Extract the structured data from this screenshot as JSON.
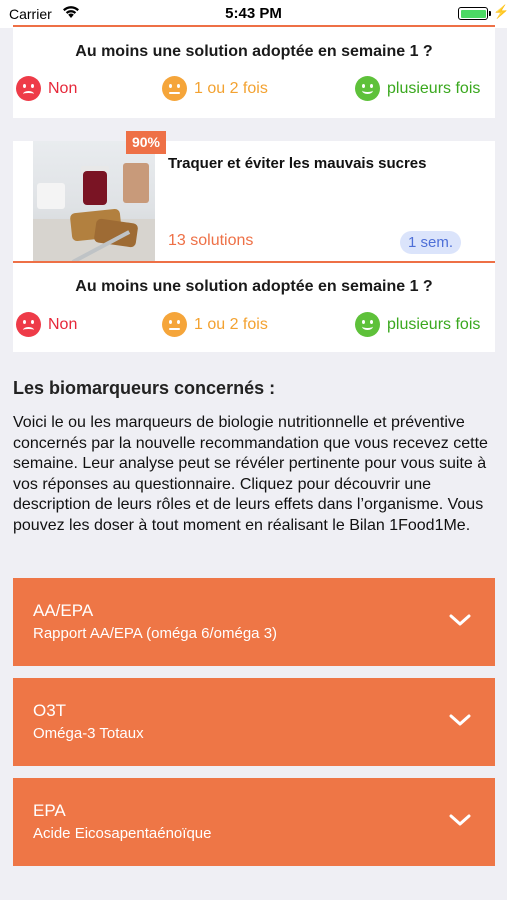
{
  "status_bar": {
    "carrier": "Carrier",
    "time": "5:43 PM",
    "battery_level": 1.0,
    "charging_glyph": "⚡"
  },
  "colors": {
    "accent": "#ee7046",
    "no": "#e6283a",
    "some": "#f3a231",
    "many": "#3aa81e",
    "duration_badge_bg": "#dbe4fb",
    "duration_badge_text": "#4e6fd7"
  },
  "question_cards": [
    {
      "question": "Au moins une solution adoptée en semaine 1 ?",
      "options": [
        {
          "icon": "sad-face-icon",
          "label": "Non"
        },
        {
          "icon": "neutral-face-icon",
          "label": "1 ou 2 fois"
        },
        {
          "icon": "happy-face-icon",
          "label": "plusieurs fois"
        }
      ]
    },
    {
      "question": "Au moins une solution adoptée en semaine 1 ?",
      "options": [
        {
          "icon": "sad-face-icon",
          "label": "Non"
        },
        {
          "icon": "neutral-face-icon",
          "label": "1 ou 2 fois"
        },
        {
          "icon": "happy-face-icon",
          "label": "plusieurs fois"
        }
      ]
    }
  ],
  "recommendation": {
    "image": "breakfast-photo",
    "badge": "90%",
    "title": "Traquer et éviter les mauvais sucres",
    "solutions": "13 solutions",
    "duration": "1 sem."
  },
  "biomarkers": {
    "heading": "Les biomarqueurs concernés :",
    "description": "Voici le ou les marqueurs de biologie nutritionnelle et préventive concernés par la nouvelle recommandation que vous recevez cette semaine. Leur analyse peut se révéler pertinente pour vous suite à vos réponses au questionnaire. Cliquez pour découvrir une description de leurs rôles et de leurs effets dans l’organisme. Vous pouvez les doser à tout moment en réalisant le Bilan 1Food1Me.",
    "items": [
      {
        "code": "AA/EPA",
        "name": "Rapport AA/EPA (oméga 6/oméga 3)",
        "icon": "chevron-down-icon"
      },
      {
        "code": "O3T",
        "name": "Oméga-3 Totaux",
        "icon": "chevron-down-icon"
      },
      {
        "code": "EPA",
        "name": "Acide Eicosapentaénoïque",
        "icon": "chevron-down-icon"
      }
    ]
  }
}
